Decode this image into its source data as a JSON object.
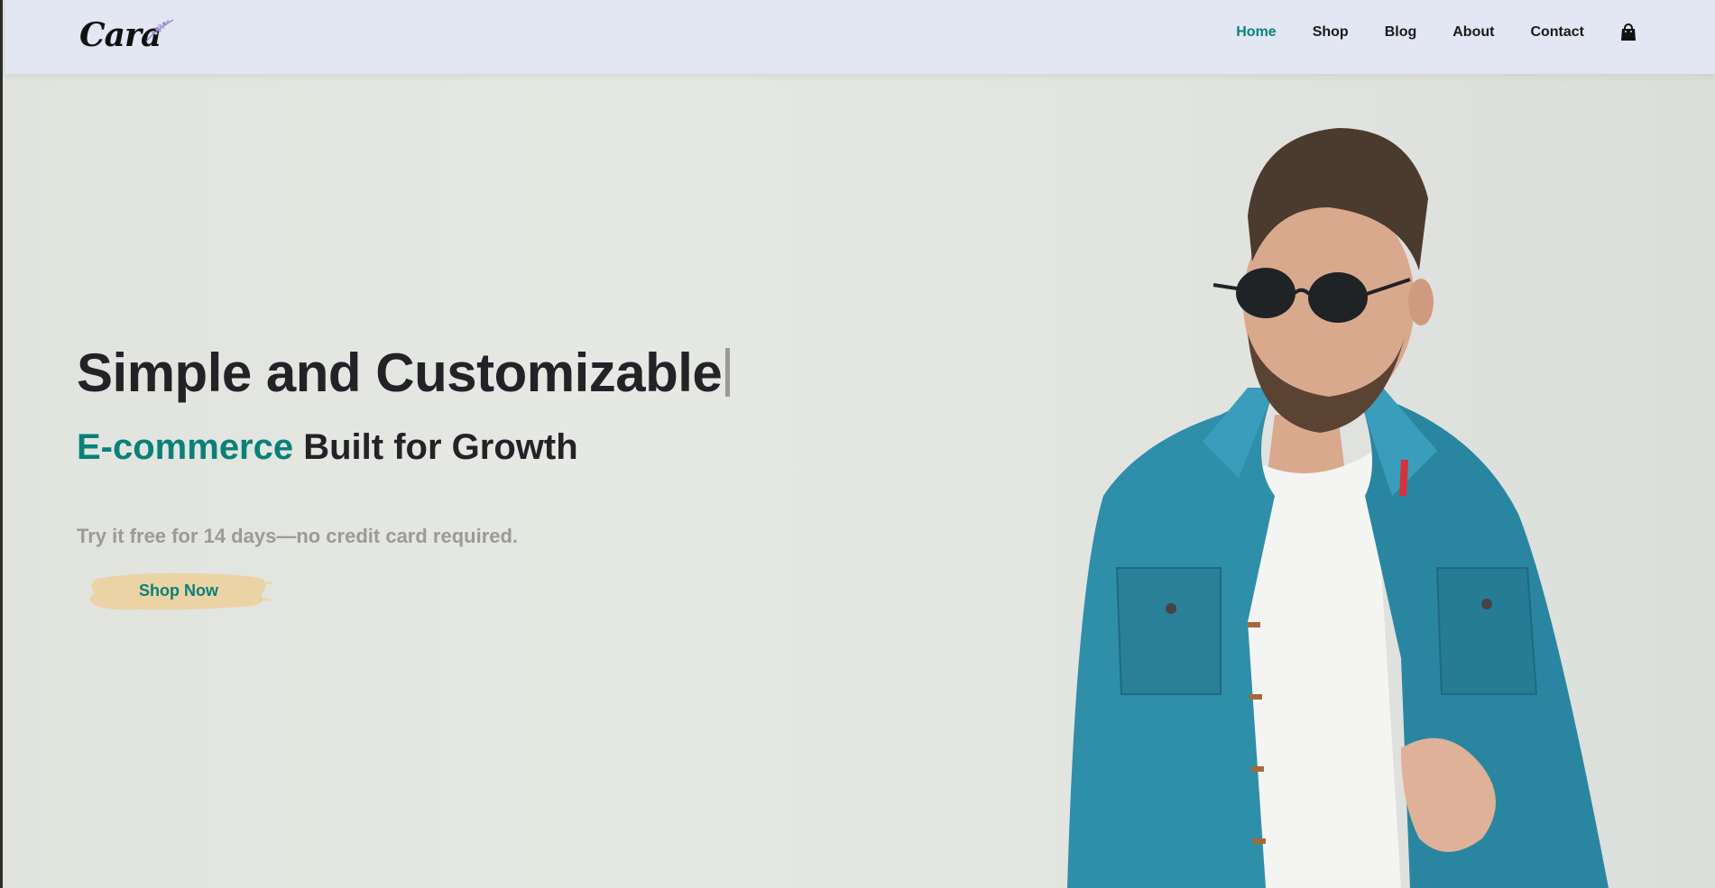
{
  "brand": {
    "logo_text": "Cara"
  },
  "nav": {
    "items": [
      {
        "label": "Home",
        "active": true
      },
      {
        "label": "Shop",
        "active": false
      },
      {
        "label": "Blog",
        "active": false
      },
      {
        "label": "About",
        "active": false
      },
      {
        "label": "Contact",
        "active": false
      }
    ],
    "cart_icon": "shopping-bag-icon"
  },
  "hero": {
    "headline": "Simple and Customizable",
    "subhead_accent": "E-commerce",
    "subhead_rest": " Built for Growth",
    "tagline": "Try it free for 14 days—no credit card required.",
    "cta_label": "Shop Now"
  },
  "colors": {
    "accent": "#088178",
    "header_bg": "#e3e6f3",
    "text_dark": "#222227",
    "tagline_gray": "#9a9a9a",
    "cta_brush": "#ecd3a6"
  }
}
